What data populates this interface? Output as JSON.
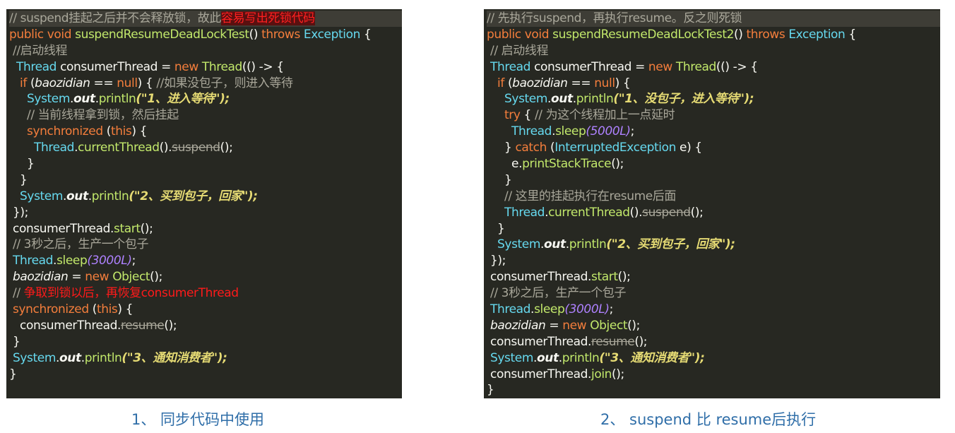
{
  "left": {
    "caption": "1、 同步代码中使用",
    "lines": [
      [
        [
          "cmt",
          "// suspend挂起之后并不会释放锁，故此"
        ],
        [
          "redbg",
          "容易写出死锁代码"
        ]
      ],
      [
        [
          "kw",
          "public void "
        ],
        [
          "fn",
          "suspendResumeDeadLockTest"
        ],
        [
          "txt",
          "() "
        ],
        [
          "kw",
          "throws "
        ],
        [
          "cls",
          "Exception"
        ],
        [
          "txt",
          " {"
        ]
      ],
      [
        [
          "cmt",
          " //启动线程"
        ]
      ],
      [
        [
          "cls",
          "  Thread "
        ],
        [
          "txt",
          "consumerThread = "
        ],
        [
          "kw",
          "new "
        ],
        [
          "fn",
          "Thread"
        ],
        [
          "txt",
          "(() -> {"
        ]
      ],
      [
        [
          "kw",
          "   if "
        ],
        [
          "txt",
          "("
        ],
        [
          "it",
          "baozidian"
        ],
        [
          "txt",
          " == "
        ],
        [
          "kw",
          "null"
        ],
        [
          "txt",
          ") { "
        ],
        [
          "cmt",
          "//如果没包子，则进入等待"
        ]
      ],
      [
        [
          "cls",
          "     System"
        ],
        [
          "txt",
          "."
        ],
        [
          "itb",
          "out"
        ],
        [
          "txt",
          "."
        ],
        [
          "fn",
          "println"
        ],
        [
          "str",
          "(\"1、进入等待\");"
        ]
      ],
      [
        [
          "cmt",
          "     // 当前线程拿到锁，然后挂起"
        ]
      ],
      [
        [
          "kw",
          "     synchronized "
        ],
        [
          "txt",
          "("
        ],
        [
          "kw",
          "this"
        ],
        [
          "txt",
          ") {"
        ]
      ],
      [
        [
          "cls",
          "       Thread"
        ],
        [
          "txt",
          "."
        ],
        [
          "fn",
          "currentThread"
        ],
        [
          "txt",
          "()."
        ],
        [
          "strike",
          "suspend"
        ],
        [
          "txt",
          "();"
        ]
      ],
      [
        [
          "txt",
          "     }"
        ]
      ],
      [
        [
          "txt",
          "   }"
        ]
      ],
      [
        [
          "cls",
          "   System"
        ],
        [
          "txt",
          "."
        ],
        [
          "itb",
          "out"
        ],
        [
          "txt",
          "."
        ],
        [
          "fn",
          "println"
        ],
        [
          "str",
          "(\"2、买到包子，回家\");"
        ]
      ],
      [
        [
          "txt",
          " });"
        ]
      ],
      [
        [
          "txt",
          " consumerThread."
        ],
        [
          "fn",
          "start"
        ],
        [
          "txt",
          "();"
        ]
      ],
      [
        [
          "cmt",
          " // 3秒之后，生产一个包子"
        ]
      ],
      [
        [
          "cls",
          " Thread"
        ],
        [
          "txt",
          "."
        ],
        [
          "fn",
          "sleep"
        ],
        [
          "num",
          "(3000L)"
        ],
        [
          "txt",
          ";"
        ]
      ],
      [
        [
          "it",
          " baozidian"
        ],
        [
          "txt",
          " = "
        ],
        [
          "kw",
          "new "
        ],
        [
          "fn",
          "Object"
        ],
        [
          "txt",
          "();"
        ]
      ],
      [
        [
          "cmt",
          " // "
        ],
        [
          "red",
          "争取到锁以后，再恢复consumerThread"
        ]
      ],
      [
        [
          "kw",
          " synchronized "
        ],
        [
          "txt",
          "("
        ],
        [
          "kw",
          "this"
        ],
        [
          "txt",
          ") {"
        ]
      ],
      [
        [
          "txt",
          "   consumerThread."
        ],
        [
          "strike",
          "resume"
        ],
        [
          "txt",
          "();"
        ]
      ],
      [
        [
          "txt",
          " }"
        ]
      ],
      [
        [
          "cls",
          " System"
        ],
        [
          "txt",
          "."
        ],
        [
          "itb",
          "out"
        ],
        [
          "txt",
          "."
        ],
        [
          "fn",
          "println"
        ],
        [
          "str",
          "(\"3、通知消费者\");"
        ]
      ],
      [
        [
          "txt",
          "}"
        ]
      ]
    ]
  },
  "right": {
    "caption": "2、 suspend 比 resume后执行",
    "lines": [
      [
        [
          "cmt",
          "// 先执行suspend，再执行resume。反之则死锁"
        ]
      ],
      [
        [
          "kw",
          "public void "
        ],
        [
          "fn",
          "suspendResumeDeadLockTest2"
        ],
        [
          "txt",
          "() "
        ],
        [
          "kw",
          "throws "
        ],
        [
          "cls",
          "Exception"
        ],
        [
          "txt",
          " {"
        ]
      ],
      [
        [
          "cmt",
          " // 启动线程"
        ]
      ],
      [
        [
          "cls",
          " Thread "
        ],
        [
          "txt",
          "consumerThread = "
        ],
        [
          "kw",
          "new "
        ],
        [
          "fn",
          "Thread"
        ],
        [
          "txt",
          "(() -> {"
        ]
      ],
      [
        [
          "kw",
          "   if "
        ],
        [
          "txt",
          "("
        ],
        [
          "it",
          "baozidian"
        ],
        [
          "txt",
          " == "
        ],
        [
          "kw",
          "null"
        ],
        [
          "txt",
          ") {"
        ]
      ],
      [
        [
          "cls",
          "     System"
        ],
        [
          "txt",
          "."
        ],
        [
          "itb",
          "out"
        ],
        [
          "txt",
          "."
        ],
        [
          "fn",
          "println"
        ],
        [
          "str",
          "(\"1、没包子，进入等待\");"
        ]
      ],
      [
        [
          "kw",
          "     try "
        ],
        [
          "txt",
          "{ "
        ],
        [
          "cmt",
          "// 为这个线程加上一点延时"
        ]
      ],
      [
        [
          "cls",
          "       Thread"
        ],
        [
          "txt",
          "."
        ],
        [
          "fn",
          "sleep"
        ],
        [
          "num",
          "(5000L)"
        ],
        [
          "txt",
          ";"
        ]
      ],
      [
        [
          "txt",
          "     } "
        ],
        [
          "kw",
          "catch "
        ],
        [
          "txt",
          "("
        ],
        [
          "cls",
          "InterruptedException"
        ],
        [
          "txt",
          " e) {"
        ]
      ],
      [
        [
          "txt",
          "       e."
        ],
        [
          "fn",
          "printStackTrace"
        ],
        [
          "txt",
          "();"
        ]
      ],
      [
        [
          "txt",
          "     }"
        ]
      ],
      [
        [
          "cmt",
          "     // 这里的挂起执行在resume后面"
        ]
      ],
      [
        [
          "cls",
          "     Thread"
        ],
        [
          "txt",
          "."
        ],
        [
          "fn",
          "currentThread"
        ],
        [
          "txt",
          "()."
        ],
        [
          "strike",
          "suspend"
        ],
        [
          "txt",
          "();"
        ]
      ],
      [
        [
          "txt",
          "   }"
        ]
      ],
      [
        [
          "cls",
          "   System"
        ],
        [
          "txt",
          "."
        ],
        [
          "itb",
          "out"
        ],
        [
          "txt",
          "."
        ],
        [
          "fn",
          "println"
        ],
        [
          "str",
          "(\"2、买到包子，回家\");"
        ]
      ],
      [
        [
          "txt",
          " });"
        ]
      ],
      [
        [
          "txt",
          " consumerThread."
        ],
        [
          "fn",
          "start"
        ],
        [
          "txt",
          "();"
        ]
      ],
      [
        [
          "cmt",
          " // 3秒之后，生产一个包子"
        ]
      ],
      [
        [
          "cls",
          " Thread"
        ],
        [
          "txt",
          "."
        ],
        [
          "fn",
          "sleep"
        ],
        [
          "num",
          "(3000L)"
        ],
        [
          "txt",
          ";"
        ]
      ],
      [
        [
          "it",
          " baozidian"
        ],
        [
          "txt",
          " = "
        ],
        [
          "kw",
          "new "
        ],
        [
          "fn",
          "Object"
        ],
        [
          "txt",
          "();"
        ]
      ],
      [
        [
          "txt",
          " consumerThread."
        ],
        [
          "strike",
          "resume"
        ],
        [
          "txt",
          "();"
        ]
      ],
      [
        [
          "cls",
          " System"
        ],
        [
          "txt",
          "."
        ],
        [
          "itb",
          "out"
        ],
        [
          "txt",
          "."
        ],
        [
          "fn",
          "println"
        ],
        [
          "str",
          "(\"3、通知消费者\");"
        ]
      ],
      [
        [
          "txt",
          " consumerThread."
        ],
        [
          "fn",
          "join"
        ],
        [
          "txt",
          "();"
        ]
      ],
      [
        [
          "txt",
          "}"
        ]
      ]
    ]
  }
}
